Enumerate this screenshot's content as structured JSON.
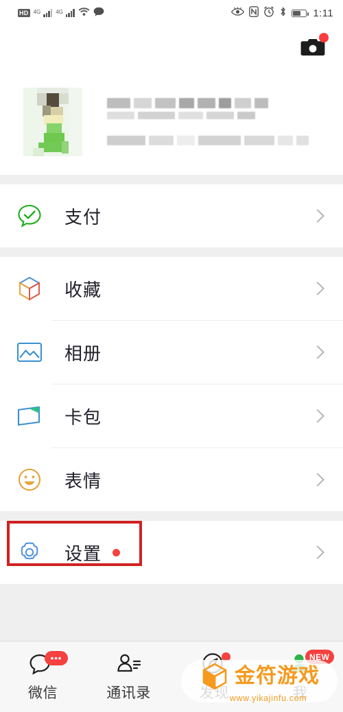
{
  "statusbar": {
    "network_label": "HD",
    "sim1_gen": "4G",
    "sim2_gen": "4G",
    "icons": [
      "hd-icon",
      "signal-4g-icon",
      "signal-4g-icon",
      "wifi-icon",
      "message-bubble-icon",
      "eye-comfort-icon",
      "nfc-icon",
      "alarm-icon",
      "bluetooth-icon",
      "battery-icon"
    ],
    "nfc_label": "N",
    "time": "1:11"
  },
  "header": {
    "camera_icon": "camera-icon",
    "camera_has_badge": true
  },
  "profile": {
    "avatar_alt": "blurred-profile-photo",
    "name_redacted": true,
    "id_redacted": true
  },
  "sections": [
    {
      "items": [
        {
          "label": "支付",
          "icon": "pay-icon",
          "icon_color": "#1aad19",
          "badge": false
        }
      ]
    },
    {
      "items": [
        {
          "label": "收藏",
          "icon": "favorites-cube-icon",
          "icon_color": "#4a90d9",
          "badge": false
        },
        {
          "label": "相册",
          "icon": "album-photo-icon",
          "icon_color": "#3a8fd0",
          "badge": false
        },
        {
          "label": "卡包",
          "icon": "card-wallet-icon",
          "icon_color": "#3a8fd0",
          "badge": false
        },
        {
          "label": "表情",
          "icon": "emoji-smiley-icon",
          "icon_color": "#e2a33a",
          "badge": false
        }
      ]
    },
    {
      "items": [
        {
          "label": "设置",
          "icon": "settings-gear-icon",
          "icon_color": "#4a90d9",
          "badge": true,
          "highlighted": true
        }
      ]
    }
  ],
  "highlight": {
    "color": "#cf2222",
    "target": "设置"
  },
  "tabbar": {
    "tabs": [
      {
        "label": "微信",
        "icon": "chat-bubble-icon",
        "badge": "•••",
        "badge_type": "dots",
        "active": false
      },
      {
        "label": "通讯录",
        "icon": "contacts-icon",
        "badge": "",
        "badge_type": "none",
        "active": false
      },
      {
        "label": "发现",
        "icon": "compass-discover-icon",
        "badge": "",
        "badge_type": "dot",
        "active": false
      },
      {
        "label": "我",
        "icon": "person-me-icon",
        "badge": "NEW",
        "badge_type": "new",
        "active": true
      }
    ],
    "active_color": "#1aad19",
    "inactive_color": "#1d1d1d"
  },
  "watermark": {
    "title": "金符游戏",
    "url": "www.yikajinfu.com",
    "color": "#f59a1e",
    "logo_icon": "orange-cube-logo-icon"
  }
}
